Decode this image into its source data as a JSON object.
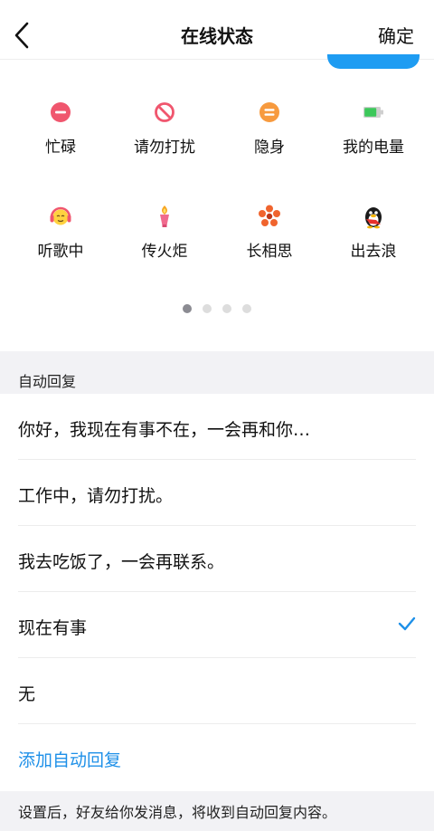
{
  "header": {
    "title": "在线状态",
    "confirm_label": "确定"
  },
  "status_items": [
    {
      "label": "忙碌",
      "icon": "busy-icon"
    },
    {
      "label": "请勿打扰",
      "icon": "do-not-disturb-icon"
    },
    {
      "label": "隐身",
      "icon": "invisible-icon"
    },
    {
      "label": "我的电量",
      "icon": "battery-icon"
    },
    {
      "label": "听歌中",
      "icon": "listening-music-icon"
    },
    {
      "label": "传火炬",
      "icon": "torch-icon"
    },
    {
      "label": "长相思",
      "icon": "flower-icon"
    },
    {
      "label": "出去浪",
      "icon": "penguin-icon"
    }
  ],
  "pager": {
    "count": 4,
    "active": 0
  },
  "auto_reply": {
    "section_title": "自动回复",
    "options": [
      {
        "text": "你好，我现在有事不在，一会再和你…",
        "selected": false
      },
      {
        "text": "工作中，请勿打扰。",
        "selected": false
      },
      {
        "text": "我去吃饭了，一会再联系。",
        "selected": false
      },
      {
        "text": "现在有事",
        "selected": true
      },
      {
        "text": "无",
        "selected": false
      }
    ],
    "add_label": "添加自动回复",
    "footer_note": "设置后，好友给你发消息，将收到自动回复内容。"
  },
  "colors": {
    "accent": "#1e90e8",
    "busy": "#f0566e",
    "dnd": "#f0566e",
    "invisible": "#f79a3e",
    "battery": "#3cc85a"
  }
}
